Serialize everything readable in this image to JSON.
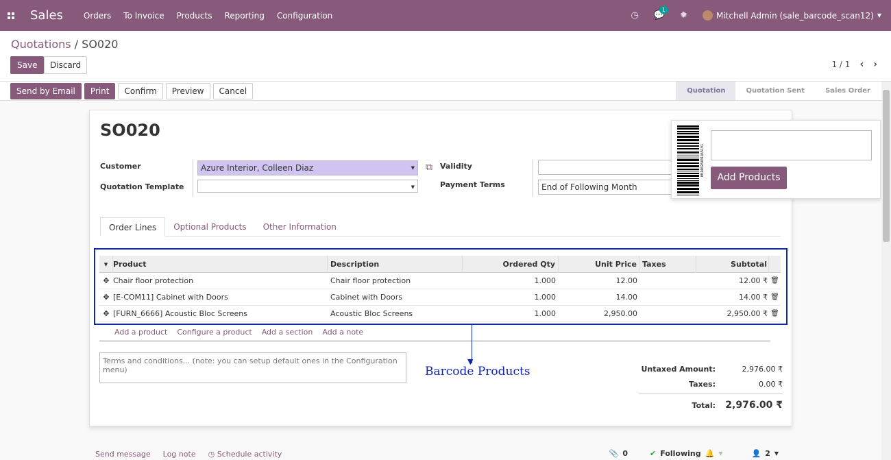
{
  "navbar": {
    "brand": "Sales",
    "menu": [
      "Orders",
      "To Invoice",
      "Products",
      "Reporting",
      "Configuration"
    ],
    "messages_count": "1",
    "user": "Mitchell Admin (sale_barcode_scan12)"
  },
  "control_panel": {
    "breadcrumb_parent": "Quotations",
    "breadcrumb_sep": " / ",
    "breadcrumb_current": "SO020",
    "save_label": "Save",
    "discard_label": "Discard",
    "pager": "1 / 1"
  },
  "statusbar": {
    "buttons": [
      "Send by Email",
      "Print",
      "Confirm",
      "Preview",
      "Cancel"
    ],
    "stages": [
      "Quotation",
      "Quotation Sent",
      "Sales Order"
    ],
    "active_stage": "Quotation"
  },
  "form": {
    "title": "SO020",
    "customer_label": "Customer",
    "customer_value": "Azure Interior, Colleen Diaz",
    "template_label": "Quotation Template",
    "template_value": "",
    "validity_label": "Validity",
    "validity_value": "",
    "payment_terms_label": "Payment Terms",
    "payment_terms_value": "End of Following Month"
  },
  "tabs": [
    "Order Lines",
    "Optional Products",
    "Other Information"
  ],
  "table": {
    "headers": [
      "Product",
      "Description",
      "Ordered Qty",
      "Unit Price",
      "Taxes",
      "Subtotal"
    ],
    "rows": [
      {
        "product": "Chair floor protection",
        "description": "Chair floor protection",
        "qty": "1.000",
        "price": "12.00",
        "taxes": "",
        "subtotal": "12.00 ₹"
      },
      {
        "product": "[E-COM11] Cabinet with Doors",
        "description": "Cabinet with Doors",
        "qty": "1.000",
        "price": "14.00",
        "taxes": "",
        "subtotal": "14.00 ₹"
      },
      {
        "product": "[FURN_6666] Acoustic Bloc Screens",
        "description": "Acoustic Bloc Screens",
        "qty": "1.000",
        "price": "2,950.00",
        "taxes": "",
        "subtotal": "2,950.00 ₹"
      }
    ],
    "add_links": [
      "Add a product",
      "Configure a product",
      "Add a section",
      "Add a note"
    ]
  },
  "terms_placeholder": "Terms and conditions... (note: you can setup default ones in the Configuration menu)",
  "annotation": "Barcode  Products",
  "totals": {
    "untaxed_label": "Untaxed Amount:",
    "untaxed_value": "2,976.00 ₹",
    "taxes_label": "Taxes:",
    "taxes_value": "0.00 ₹",
    "total_label": "Total:",
    "total_value": "2,976.00 ₹"
  },
  "barcode_popup": {
    "add_products_label": "Add Products",
    "barcode_digits": "0014028401465191"
  },
  "chatter": {
    "send_message": "Send message",
    "log_note": "Log note",
    "schedule_activity": "Schedule activity",
    "attachments": "0",
    "following": "Following",
    "followers": "2"
  },
  "colors": {
    "brand": "#875a7b",
    "annotation": "#1226a8",
    "required_field": "#d2c4f0"
  }
}
